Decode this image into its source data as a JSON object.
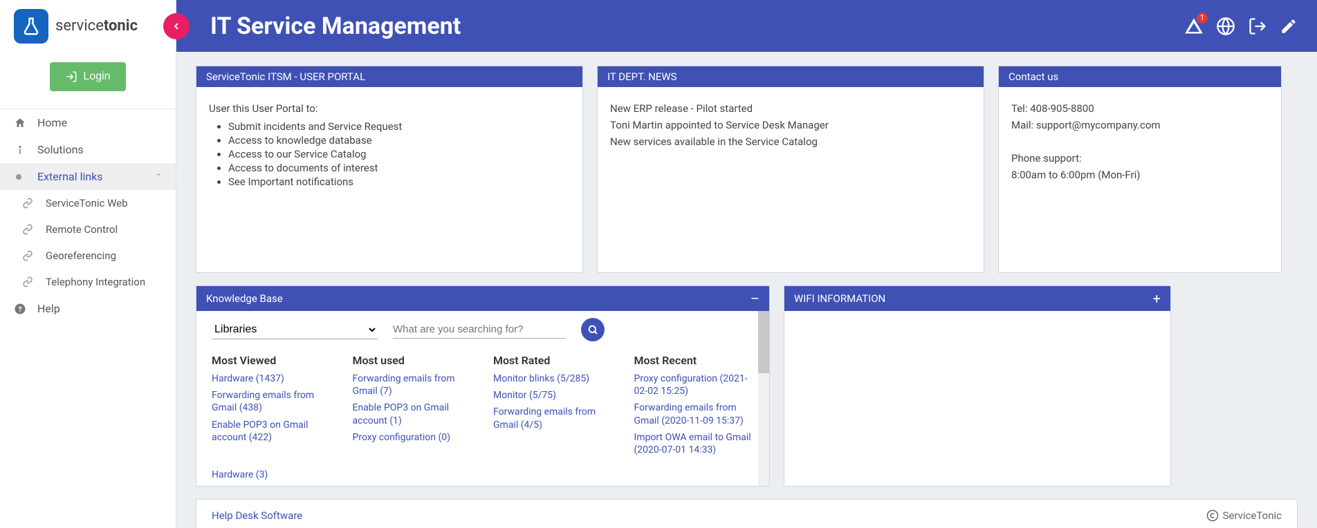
{
  "brand": {
    "name_prefix": "service",
    "name_suffix": "tonic"
  },
  "login_label": "Login",
  "page_title": "IT Service Management",
  "alert_badge": "1",
  "nav": {
    "home": "Home",
    "solutions": "Solutions",
    "external_links": "External links",
    "servicetonic_web": "ServiceTonic Web",
    "remote_control": "Remote Control",
    "georeferencing": "Georeferencing",
    "telephony": "Telephony Integration",
    "help": "Help"
  },
  "cards": {
    "portal": {
      "title": "ServiceTonic ITSM - USER PORTAL",
      "intro": "User this User Portal to:",
      "items": [
        "Submit incidents and Service Request",
        "Access to knowledge database",
        "Access to our Service Catalog",
        "Access to documents of interest",
        "See Important notifications"
      ]
    },
    "news": {
      "title": "IT DEPT. NEWS",
      "items": [
        "New ERP release - Pilot started",
        "Toni Martin appointed to Service Desk Manager",
        "New services available in the Service Catalog"
      ]
    },
    "contact": {
      "title": "Contact us",
      "tel": "Tel: 408-905-8800",
      "mail": "Mail: support@mycompany.com",
      "phone_support_label": "Phone support:",
      "phone_support_hours": "8:00am to 6:00pm (Mon-Fri)"
    },
    "kb": {
      "title": "Knowledge Base",
      "select_label": "Libraries",
      "search_placeholder": "What are you searching for?",
      "cols": {
        "most_viewed": {
          "heading": "Most Viewed",
          "links": [
            "Hardware (1437)",
            "Forwarding emails from Gmail (438)",
            "Enable POP3 on Gmail account (422)"
          ]
        },
        "most_used": {
          "heading": "Most used",
          "links": [
            "Forwarding emails from Gmail (7)",
            "Enable POP3 on Gmail account (1)",
            "Proxy configuration (0)"
          ]
        },
        "most_rated": {
          "heading": "Most Rated",
          "links": [
            "Monitor blinks (5/285)",
            "Monitor (5/75)",
            "Forwarding emails from Gmail (4/5)"
          ]
        },
        "most_recent": {
          "heading": "Most Recent",
          "links": [
            "Proxy configuration (2021-02-02 15:25)",
            "Forwarding emails from Gmail (2020-11-09 15:37)",
            "Import OWA email to Gmail (2020-07-01 14:33)"
          ]
        }
      },
      "footer_link": "Hardware (3)"
    },
    "wifi": {
      "title": "WIFI INFORMATION"
    }
  },
  "footer": {
    "link": "Help Desk Software",
    "credit": "ServiceTonic"
  }
}
